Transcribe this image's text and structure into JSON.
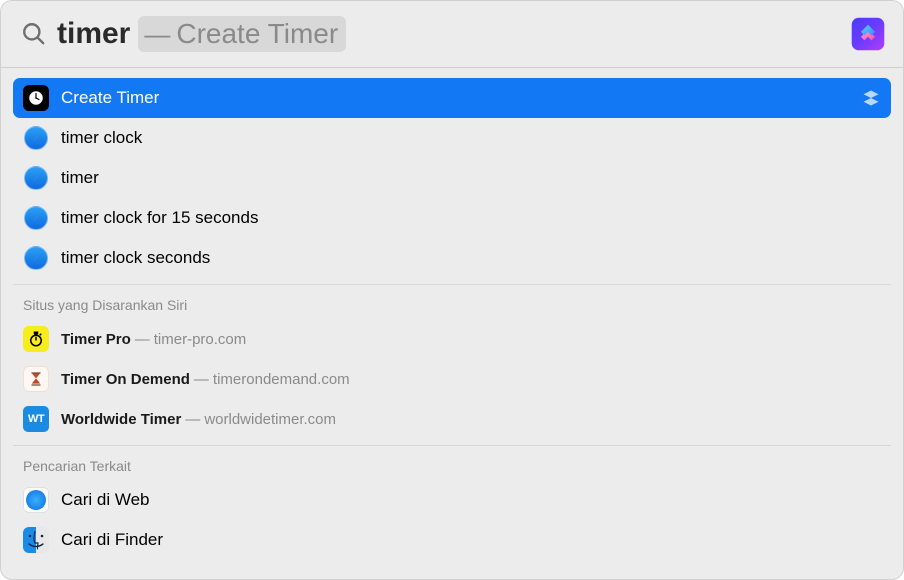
{
  "search": {
    "query": "timer",
    "suggestion_dash": "—",
    "suggestion": "Create Timer"
  },
  "top_hit": {
    "label": "Create Timer"
  },
  "history": [
    {
      "label": "timer clock"
    },
    {
      "label": "timer"
    },
    {
      "label": "timer clock for 15 seconds"
    },
    {
      "label": "timer clock seconds"
    }
  ],
  "sections": {
    "siri_sites_title": "Situs yang Disarankan Siri",
    "related_title": "Pencarian Terkait"
  },
  "siri_sites": [
    {
      "name": "Timer Pro",
      "dash": "—",
      "domain": "timer-pro.com",
      "icon": "timer-pro"
    },
    {
      "name": "Timer On Demend",
      "dash": "—",
      "domain": "timerondemand.com",
      "icon": "hourglass"
    },
    {
      "name": "Worldwide Timer",
      "dash": "—",
      "domain": "worldwidetimer.com",
      "icon": "wt"
    }
  ],
  "related": [
    {
      "label": "Cari di Web"
    },
    {
      "label": "Cari di Finder"
    }
  ]
}
